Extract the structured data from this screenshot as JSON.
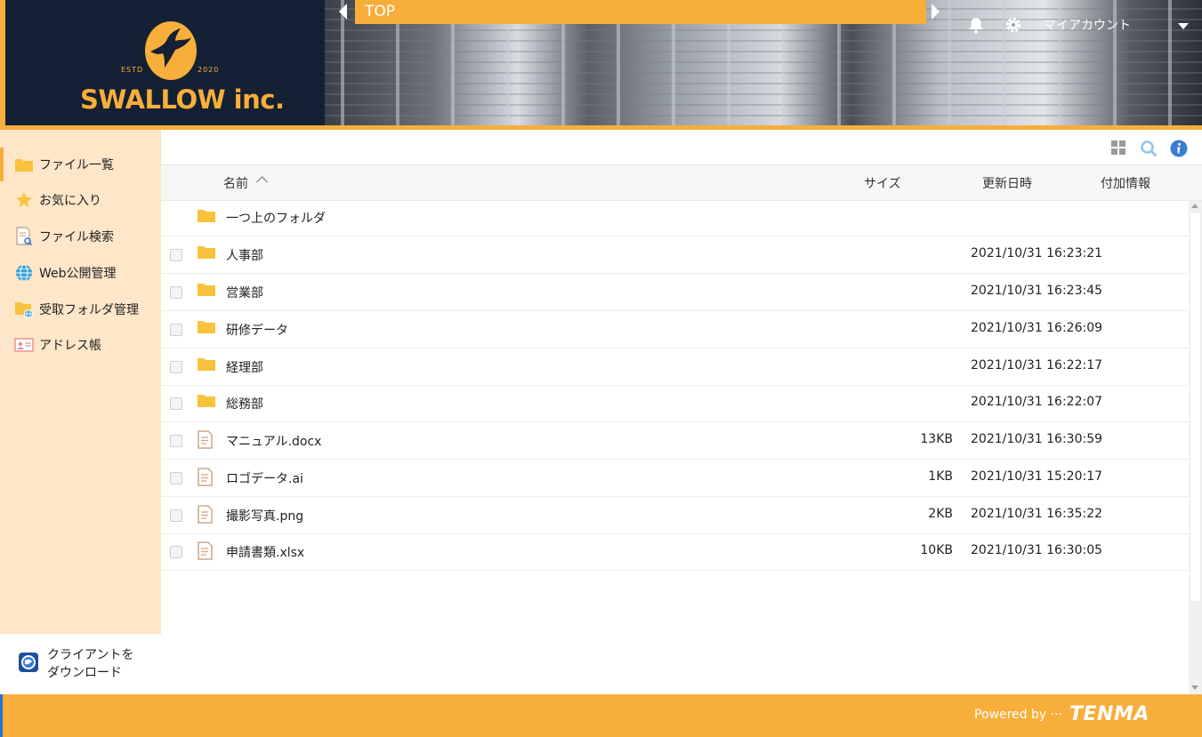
{
  "brand": {
    "estd": "ESTD",
    "year": "2020",
    "name": "SWALLOW inc."
  },
  "header": {
    "breadcrumb": "TOP",
    "account_label": "マイアカウント"
  },
  "sidebar": {
    "items": [
      {
        "label": "ファイル一覧",
        "icon": "folder-icon",
        "active": true
      },
      {
        "label": "お気に入り",
        "icon": "star-icon"
      },
      {
        "label": "ファイル検索",
        "icon": "file-search-icon"
      },
      {
        "label": "Web公開管理",
        "icon": "globe-icon"
      },
      {
        "label": "受取フォルダ管理",
        "icon": "folder-globe-icon"
      },
      {
        "label": "アドレス帳",
        "icon": "address-card-icon"
      }
    ],
    "download_line1": "クライアントを",
    "download_line2": "ダウンロード"
  },
  "table": {
    "headers": {
      "name": "名前",
      "size": "サイズ",
      "modified": "更新日時",
      "info": "付加情報"
    },
    "parent_folder": "一つ上のフォルダ",
    "rows": [
      {
        "type": "folder",
        "name": "人事部",
        "size": "",
        "modified": "2021/10/31 16:23:21"
      },
      {
        "type": "folder",
        "name": "営業部",
        "size": "",
        "modified": "2021/10/31 16:23:45"
      },
      {
        "type": "folder",
        "name": "研修データ",
        "size": "",
        "modified": "2021/10/31 16:26:09"
      },
      {
        "type": "folder",
        "name": "経理部",
        "size": "",
        "modified": "2021/10/31 16:22:17"
      },
      {
        "type": "folder",
        "name": "総務部",
        "size": "",
        "modified": "2021/10/31 16:22:07"
      },
      {
        "type": "file",
        "name": "マニュアル.docx",
        "size": "13KB",
        "modified": "2021/10/31 16:30:59"
      },
      {
        "type": "file",
        "name": "ロゴデータ.ai",
        "size": "1KB",
        "modified": "2021/10/31 15:20:17"
      },
      {
        "type": "file",
        "name": "撮影写真.png",
        "size": "2KB",
        "modified": "2021/10/31 16:35:22"
      },
      {
        "type": "file",
        "name": "申請書類.xlsx",
        "size": "10KB",
        "modified": "2021/10/31 16:30:05"
      }
    ]
  },
  "footer": {
    "powered_by": "Powered by ···",
    "vendor": "TENMA"
  },
  "colors": {
    "accent": "#f8ae3a",
    "sidebar_bg": "#fee6c8",
    "header_dark": "#142033",
    "folder": "#f9c23c"
  }
}
